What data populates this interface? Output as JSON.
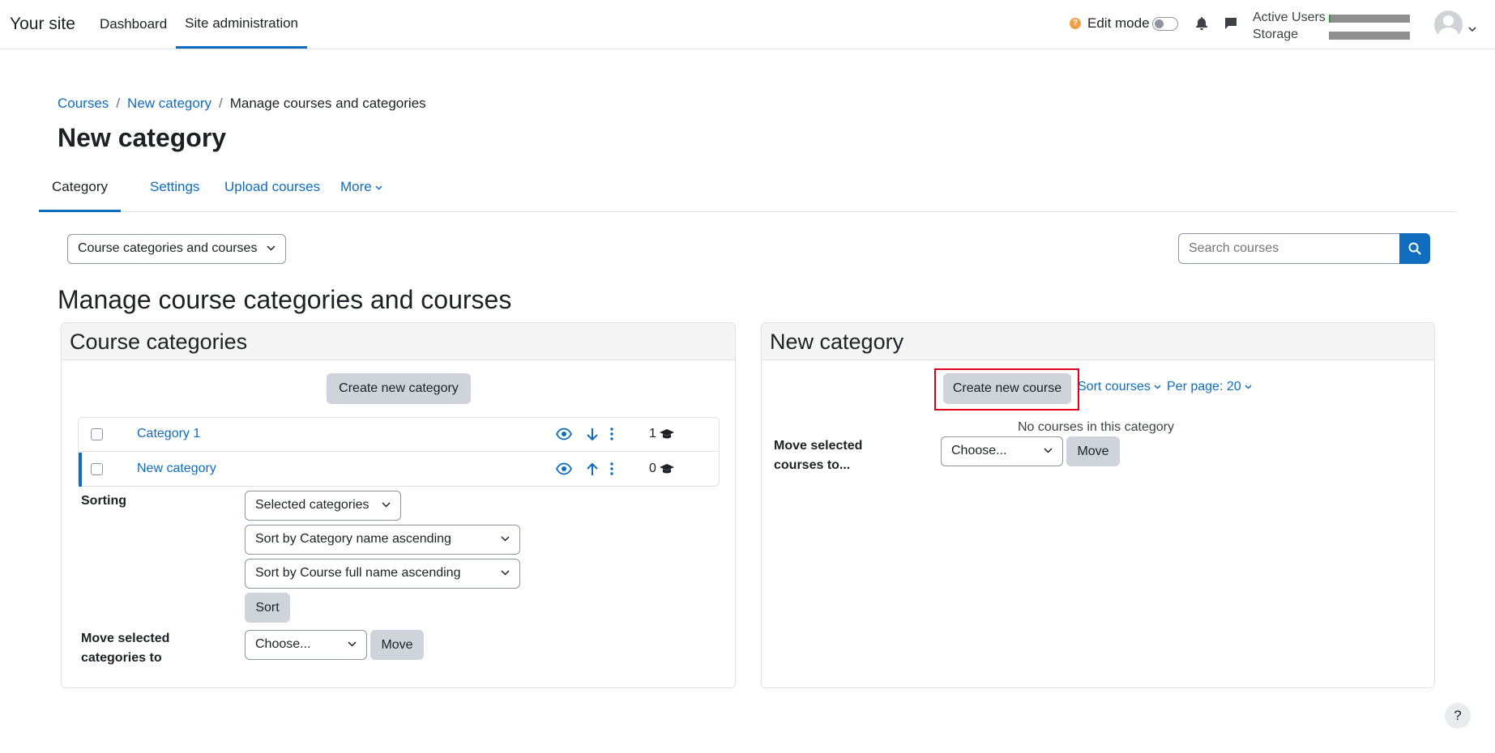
{
  "navbar": {
    "brand": "Your site",
    "items": [
      {
        "label": "Dashboard",
        "active": false
      },
      {
        "label": "Site administration",
        "active": true
      }
    ],
    "edit_mode_label": "Edit mode",
    "active_users_label": "Active Users",
    "storage_label": "Storage"
  },
  "breadcrumb": {
    "items": [
      "Courses",
      "New category",
      "Manage courses and categories"
    ],
    "separator": "/"
  },
  "page_title": "New category",
  "secondary_nav": {
    "tabs": [
      "Category",
      "Settings",
      "Upload courses",
      "More"
    ]
  },
  "view_select": {
    "selected": "Course categories and courses"
  },
  "search": {
    "placeholder": "Search courses"
  },
  "manage_heading": "Manage course categories and courses",
  "left_panel": {
    "title": "Course categories",
    "create_label": "Create new category",
    "categories": [
      {
        "name": "Category 1",
        "count": "1"
      },
      {
        "name": "New category",
        "count": "0"
      }
    ],
    "sorting_label": "Sorting",
    "sorting_scope": "Selected categories",
    "sort_category": "Sort by Category name ascending",
    "sort_course": "Sort by Course full name ascending",
    "sort_button": "Sort",
    "move_label": "Move selected categories to",
    "move_select": "Choose...",
    "move_button": "Move"
  },
  "right_panel": {
    "title": "New category",
    "create_label": "Create new course",
    "sort_courses": "Sort courses",
    "per_page": "Per page: 20",
    "no_courses": "No courses in this category",
    "move_label": "Move selected courses to...",
    "move_select": "Choose...",
    "move_button": "Move"
  },
  "help": {
    "label": "?"
  },
  "status": {
    "active_users_fraction": 0.02,
    "storage_fraction": 0.0
  },
  "colors": {
    "accent": "#0f6cbf",
    "highlight": "#e0001b"
  }
}
